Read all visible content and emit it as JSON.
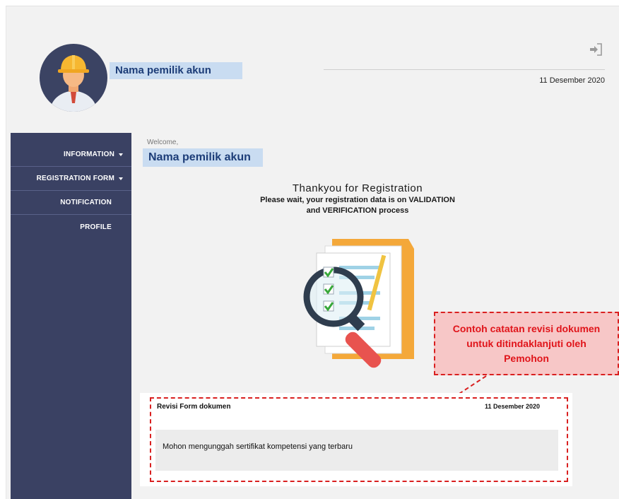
{
  "header": {
    "owner_name": "Nama pemilik akun",
    "date": "11 Desember 2020",
    "logout_icon": "logout-icon"
  },
  "sidebar": {
    "items": [
      {
        "label": "INFORMATION",
        "has_caret": true
      },
      {
        "label": "REGISTRATION FORM",
        "has_caret": true
      },
      {
        "label": "NOTIFICATION",
        "has_caret": false
      },
      {
        "label": "PROFILE",
        "has_caret": false
      }
    ]
  },
  "main": {
    "welcome_label": "Welcome,",
    "owner_name": "Nama pemilik akun",
    "thanks_title": "Thankyou for Registration",
    "thanks_line1": "Please wait, your registration data is on VALIDATION",
    "thanks_line2": "and VERIFICATION process",
    "illustration": "document-magnifier-illustration"
  },
  "callout": {
    "line1": "Contoh catatan revisi dokumen",
    "line2": "untuk ditindaklanjuti oleh",
    "line3": "Pemohon"
  },
  "revision": {
    "title": "Revisi Form dokumen",
    "date": "11 Desember 2020",
    "note": "Mohon mengunggah sertifikat kompetensi yang terbaru"
  },
  "colors": {
    "sidebar": "#3a4163",
    "highlight": "#c9dcf1",
    "annotation_red": "#d92020",
    "callout_fill": "#f7c7c7"
  }
}
